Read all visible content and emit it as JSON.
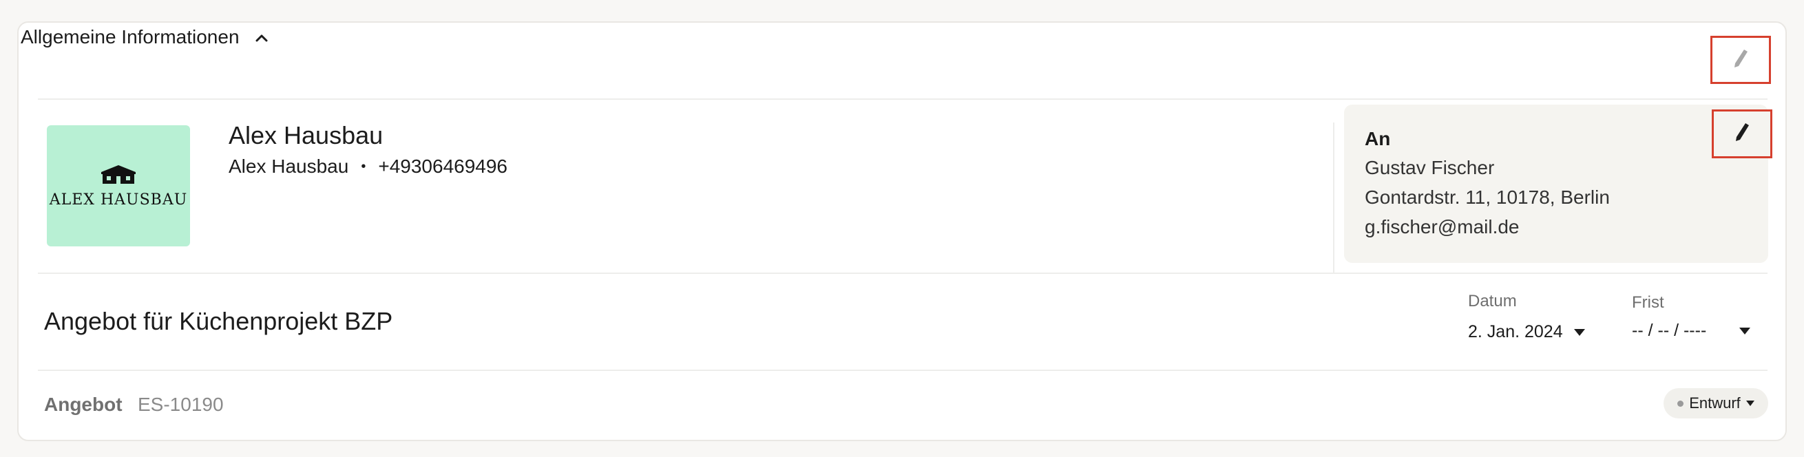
{
  "section": {
    "title": "Allgemeine Informationen"
  },
  "company": {
    "logo_text": "ALEX HAUSBAU",
    "name": "Alex Hausbau",
    "sub_name": "Alex Hausbau",
    "separator": "•",
    "phone": "+49306469496",
    "logo_bg": "#b8f0d4"
  },
  "recipient": {
    "title": "An",
    "name": "Gustav Fischer",
    "address": "Gontardstr. 11, 10178, Berlin",
    "email": "g.fischer@mail.de"
  },
  "quote": {
    "title": "Angebot für Küchenprojekt BZP",
    "date_label": "Datum",
    "date_value": "2. Jan. 2024",
    "deadline_label": "Frist",
    "deadline_value": "-- / -- / ----"
  },
  "footer": {
    "doc_type": "Angebot",
    "doc_number": "ES-10190",
    "status": "Entwurf"
  },
  "colors": {
    "highlight_border": "#d6402e",
    "page_bg": "#f8f7f5",
    "card_bg": "#ffffff",
    "recipient_bg": "#f5f4f0"
  }
}
